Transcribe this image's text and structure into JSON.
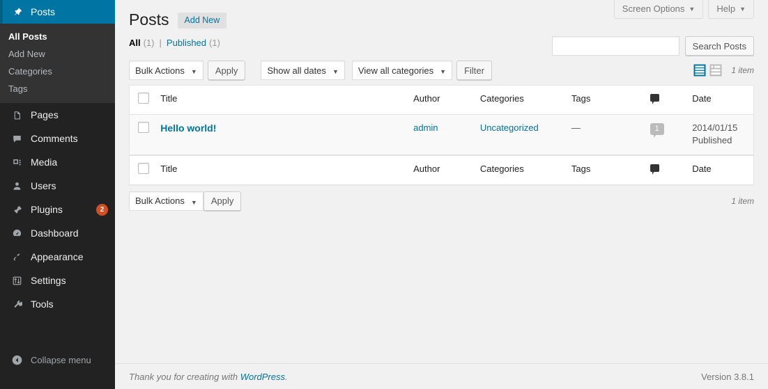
{
  "sidebar": {
    "items": [
      {
        "label": "Posts",
        "icon": "pin-icon",
        "active": true,
        "submenu": [
          {
            "label": "All Posts",
            "current": true
          },
          {
            "label": "Add New",
            "current": false
          },
          {
            "label": "Categories",
            "current": false
          },
          {
            "label": "Tags",
            "current": false
          }
        ]
      },
      {
        "label": "Pages",
        "icon": "page-icon",
        "active": false
      },
      {
        "label": "Comments",
        "icon": "comment-icon",
        "active": false
      },
      {
        "label": "Media",
        "icon": "media-icon",
        "active": false
      },
      {
        "label": "Users",
        "icon": "user-icon",
        "active": false
      },
      {
        "label": "Plugins",
        "icon": "plug-icon",
        "active": false,
        "badge": "2"
      },
      {
        "label": "Dashboard",
        "icon": "dashboard-icon",
        "active": false
      },
      {
        "label": "Appearance",
        "icon": "appearance-icon",
        "active": false
      },
      {
        "label": "Settings",
        "icon": "settings-icon",
        "active": false
      },
      {
        "label": "Tools",
        "icon": "tools-icon",
        "active": false
      }
    ],
    "collapse_label": "Collapse menu",
    "collapse_icon": "collapse-left-icon",
    "colors": {
      "background": "#222222",
      "submenu_background": "#333333",
      "active": "#0074a2",
      "badge": "#d54e21",
      "text": "#eeeeee",
      "muted_text": "#b4b9be"
    }
  },
  "screen_meta": {
    "screen_options_label": "Screen Options",
    "help_label": "Help",
    "caret": "▼"
  },
  "page": {
    "title": "Posts",
    "add_new_label": "Add New"
  },
  "status_filters": {
    "separator": "|",
    "items": [
      {
        "label": "All",
        "count": "(1)",
        "current": true
      },
      {
        "label": "Published",
        "count": "(1)",
        "current": false
      }
    ]
  },
  "search": {
    "value": "",
    "placeholder": "",
    "button_label": "Search Posts"
  },
  "toolbar_top": {
    "bulk_actions_label": "Bulk Actions",
    "apply_label": "Apply",
    "dates_label": "Show all dates",
    "categories_label": "View all categories",
    "filter_label": "Filter",
    "caret": "▼",
    "view_list_icon": "list-view-icon",
    "view_excerpt_icon": "excerpt-view-icon",
    "active_view": "list",
    "displaying_num": "1 item",
    "active_view_color": "#0074a2",
    "inactive_view_color": "#bbbbbb"
  },
  "toolbar_bottom": {
    "bulk_actions_label": "Bulk Actions",
    "apply_label": "Apply",
    "caret": "▼",
    "displaying_num": "1 item"
  },
  "table": {
    "columns": [
      {
        "key": "title",
        "label": "Title"
      },
      {
        "key": "author",
        "label": "Author"
      },
      {
        "key": "categories",
        "label": "Categories"
      },
      {
        "key": "tags",
        "label": "Tags"
      },
      {
        "key": "comments",
        "label": "",
        "icon": "comment-icon"
      },
      {
        "key": "date",
        "label": "Date"
      }
    ],
    "rows": [
      {
        "title": "Hello world!",
        "author": "admin",
        "categories": "Uncategorized",
        "tags": "—",
        "comments": "1",
        "date": "2014/01/15",
        "status": "Published"
      }
    ]
  },
  "footer": {
    "thanks_prefix": "Thank you for creating with ",
    "wordpress_link": "WordPress",
    "thanks_suffix": ".",
    "version": "Version 3.8.1"
  }
}
